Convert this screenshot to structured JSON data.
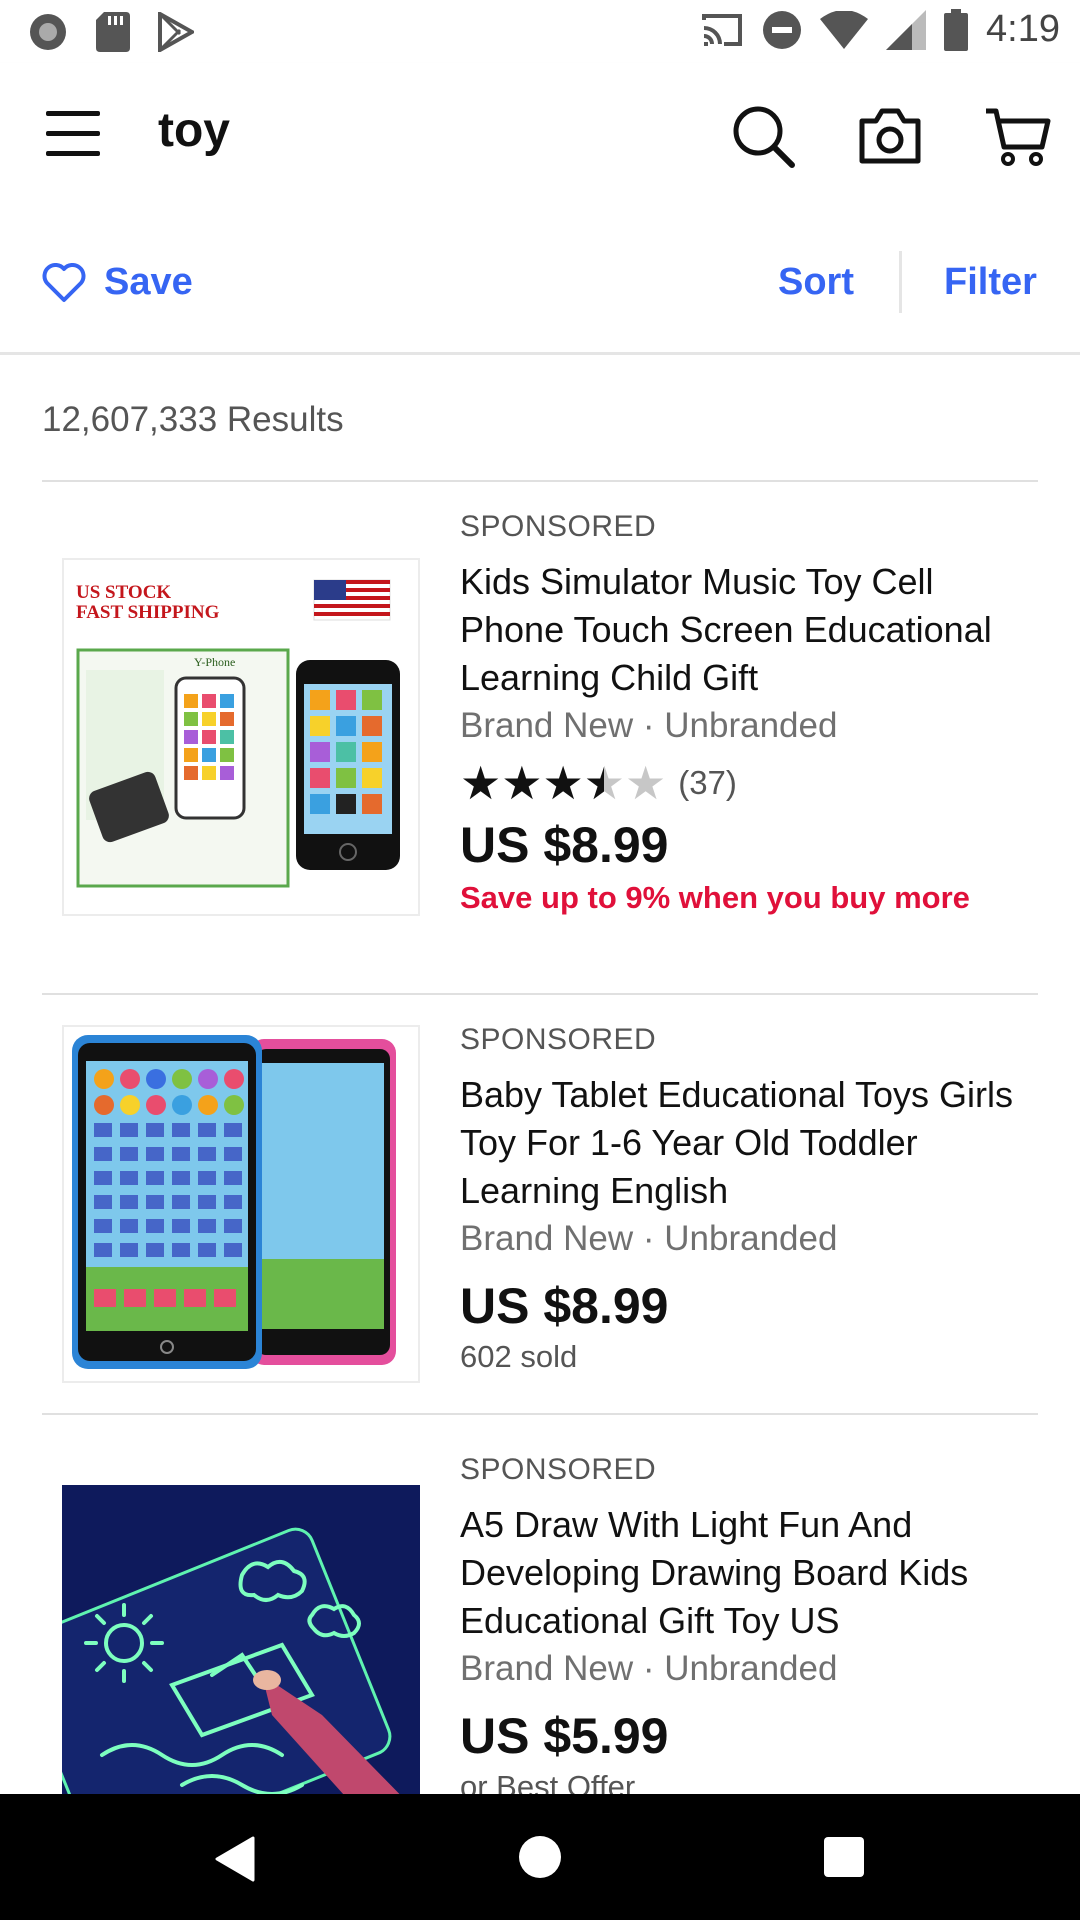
{
  "status_bar": {
    "time": "4:19",
    "icons": [
      "record-icon",
      "sd-card-icon",
      "play-store-icon",
      "cast-icon",
      "do-not-disturb-icon",
      "wifi-icon",
      "signal-icon",
      "battery-icon"
    ]
  },
  "app_bar": {
    "menu_icon": "menu-icon",
    "query": "toy",
    "search_icon": "search-icon",
    "camera_icon": "camera-icon",
    "cart_icon": "cart-icon"
  },
  "actions": {
    "save_label": "Save",
    "sort_label": "Sort",
    "filter_label": "Filter",
    "accent_color": "#3665f3"
  },
  "results_count": "12,607,333 Results",
  "listings": [
    {
      "sponsored": "SPONSORED",
      "title": "Kids Simulator Music Toy Cell Phone Touch Screen Educational Learning Child Gift",
      "condition": "Brand New · Unbranded",
      "rating": 3.5,
      "rating_count": "(37)",
      "price": "US $8.99",
      "promo": "Save up to 9% when you buy more",
      "image_text": {
        "banner": "US STOCK",
        "banner2": "FAST SHIPPING",
        "box_label": "Y-Phone"
      }
    },
    {
      "sponsored": "SPONSORED",
      "title": "Baby Tablet Educational Toys Girls Toy For 1-6 Year Old Toddler Learning English",
      "condition": "Brand New · Unbranded",
      "price": "US $8.99",
      "sold": "602 sold"
    },
    {
      "sponsored": "SPONSORED",
      "title": "A5 Draw With Light Fun And Developing Drawing Board Kids Educational Gift Toy US",
      "condition": "Brand New · Unbranded",
      "price": "US $5.99",
      "sold": "or Best Offer"
    }
  ],
  "promo_color": "#e0103a",
  "nav_bar": {
    "back_icon": "back-icon",
    "home_icon": "home-icon",
    "recents_icon": "recents-icon"
  }
}
